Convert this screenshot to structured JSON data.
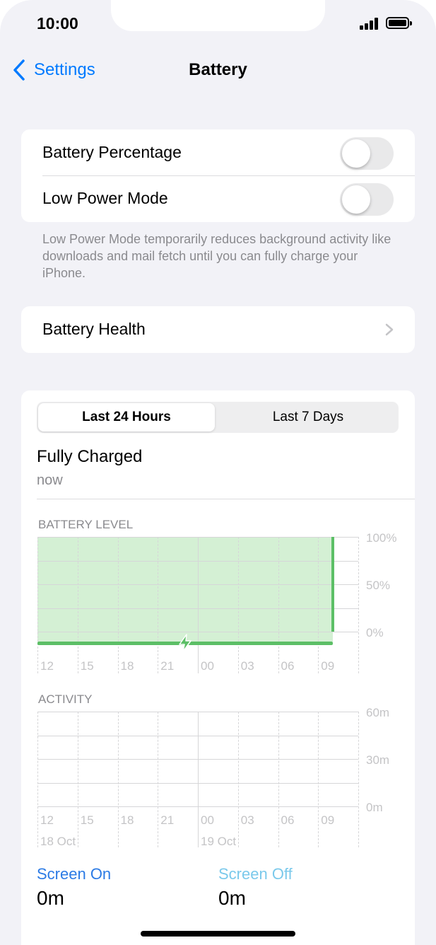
{
  "status_bar": {
    "time": "10:00"
  },
  "nav": {
    "back_label": "Settings",
    "title": "Battery"
  },
  "settings_group": {
    "battery_percentage": {
      "label": "Battery Percentage",
      "on": false
    },
    "low_power_mode": {
      "label": "Low Power Mode",
      "on": false
    }
  },
  "low_power_footnote": "Low Power Mode temporarily reduces background activity like downloads and mail fetch until you can fully charge your iPhone.",
  "battery_health": {
    "label": "Battery Health"
  },
  "usage": {
    "segment": {
      "options": [
        "Last 24 Hours",
        "Last 7 Days"
      ],
      "selected": "Last 24 Hours"
    },
    "charged_title": "Fully Charged",
    "charged_subtitle": "now",
    "legend": {
      "screen_on": {
        "label": "Screen On",
        "value": "0m",
        "color": "#2c7be5"
      },
      "screen_off": {
        "label": "Screen Off",
        "value": "0m",
        "color": "#7bc9eb"
      }
    }
  },
  "chart_data": [
    {
      "type": "area",
      "title": "BATTERY LEVEL",
      "x": [
        "12",
        "15",
        "18",
        "21",
        "00",
        "03",
        "06",
        "09"
      ],
      "y_ticks": [
        "100%",
        "50%",
        "0%"
      ],
      "ylim": [
        0,
        100
      ],
      "series": [
        {
          "values": [
            100,
            100,
            100,
            100,
            100,
            100,
            100,
            100
          ]
        }
      ],
      "charging": true,
      "fill_color": "#d4f0d4",
      "line_color": "#5cbf66"
    },
    {
      "type": "bar",
      "title": "ACTIVITY",
      "x": [
        "12",
        "15",
        "18",
        "21",
        "00",
        "03",
        "06",
        "09"
      ],
      "date_labels": [
        "18 Oct",
        "19 Oct"
      ],
      "y_ticks": [
        "60m",
        "30m",
        "0m"
      ],
      "ylim": [
        0,
        60
      ],
      "series": [
        {
          "name": "Screen On",
          "values": [
            0,
            0,
            0,
            0,
            0,
            0,
            0,
            0
          ]
        },
        {
          "name": "Screen Off",
          "values": [
            0,
            0,
            0,
            0,
            0,
            0,
            0,
            0
          ]
        }
      ]
    }
  ]
}
